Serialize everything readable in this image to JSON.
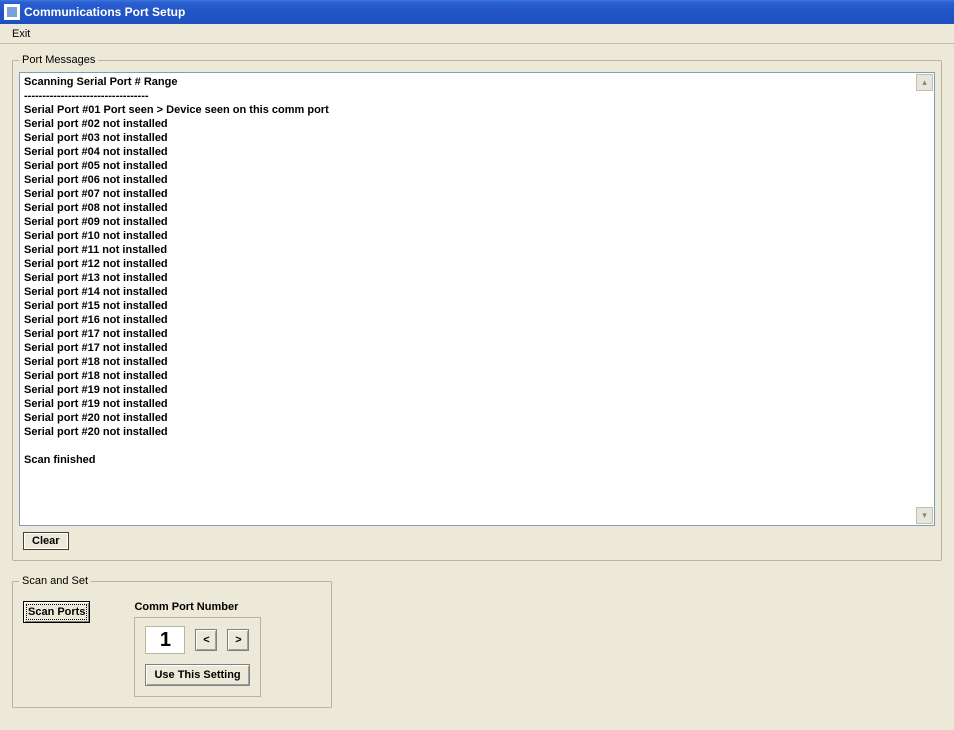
{
  "window": {
    "title": "Communications Port Setup"
  },
  "menu": {
    "exit": "Exit"
  },
  "port_messages": {
    "legend": "Port Messages",
    "lines": [
      "Scanning Serial Port # Range",
      "----------------------------------",
      "Serial Port #01 Port seen > Device seen on this comm port",
      "Serial port #02 not installed",
      "Serial port #03 not installed",
      "Serial port #04 not installed",
      "Serial port #05 not installed",
      "Serial port #06 not installed",
      "Serial port #07 not installed",
      "Serial port #08 not installed",
      "Serial port #09 not installed",
      "Serial port #10 not installed",
      "Serial port #11 not installed",
      "Serial port #12 not installed",
      "Serial port #13 not installed",
      "Serial port #14 not installed",
      "Serial port #15 not installed",
      "Serial port #16 not installed",
      "Serial port #17 not installed",
      "Serial port #17 not installed",
      "Serial port #18 not installed",
      "Serial port #18 not installed",
      "Serial port #19 not installed",
      "Serial port #19 not installed",
      "Serial port #20 not installed",
      "Serial port #20 not installed",
      "",
      "Scan finished"
    ],
    "clear_label": "Clear"
  },
  "scan_set": {
    "legend": "Scan and Set",
    "scan_ports_label": "Scan Ports",
    "comm_port_label": "Comm Port Number",
    "port_value": "1",
    "prev_label": "<",
    "next_label": ">",
    "use_label": "Use This Setting"
  }
}
